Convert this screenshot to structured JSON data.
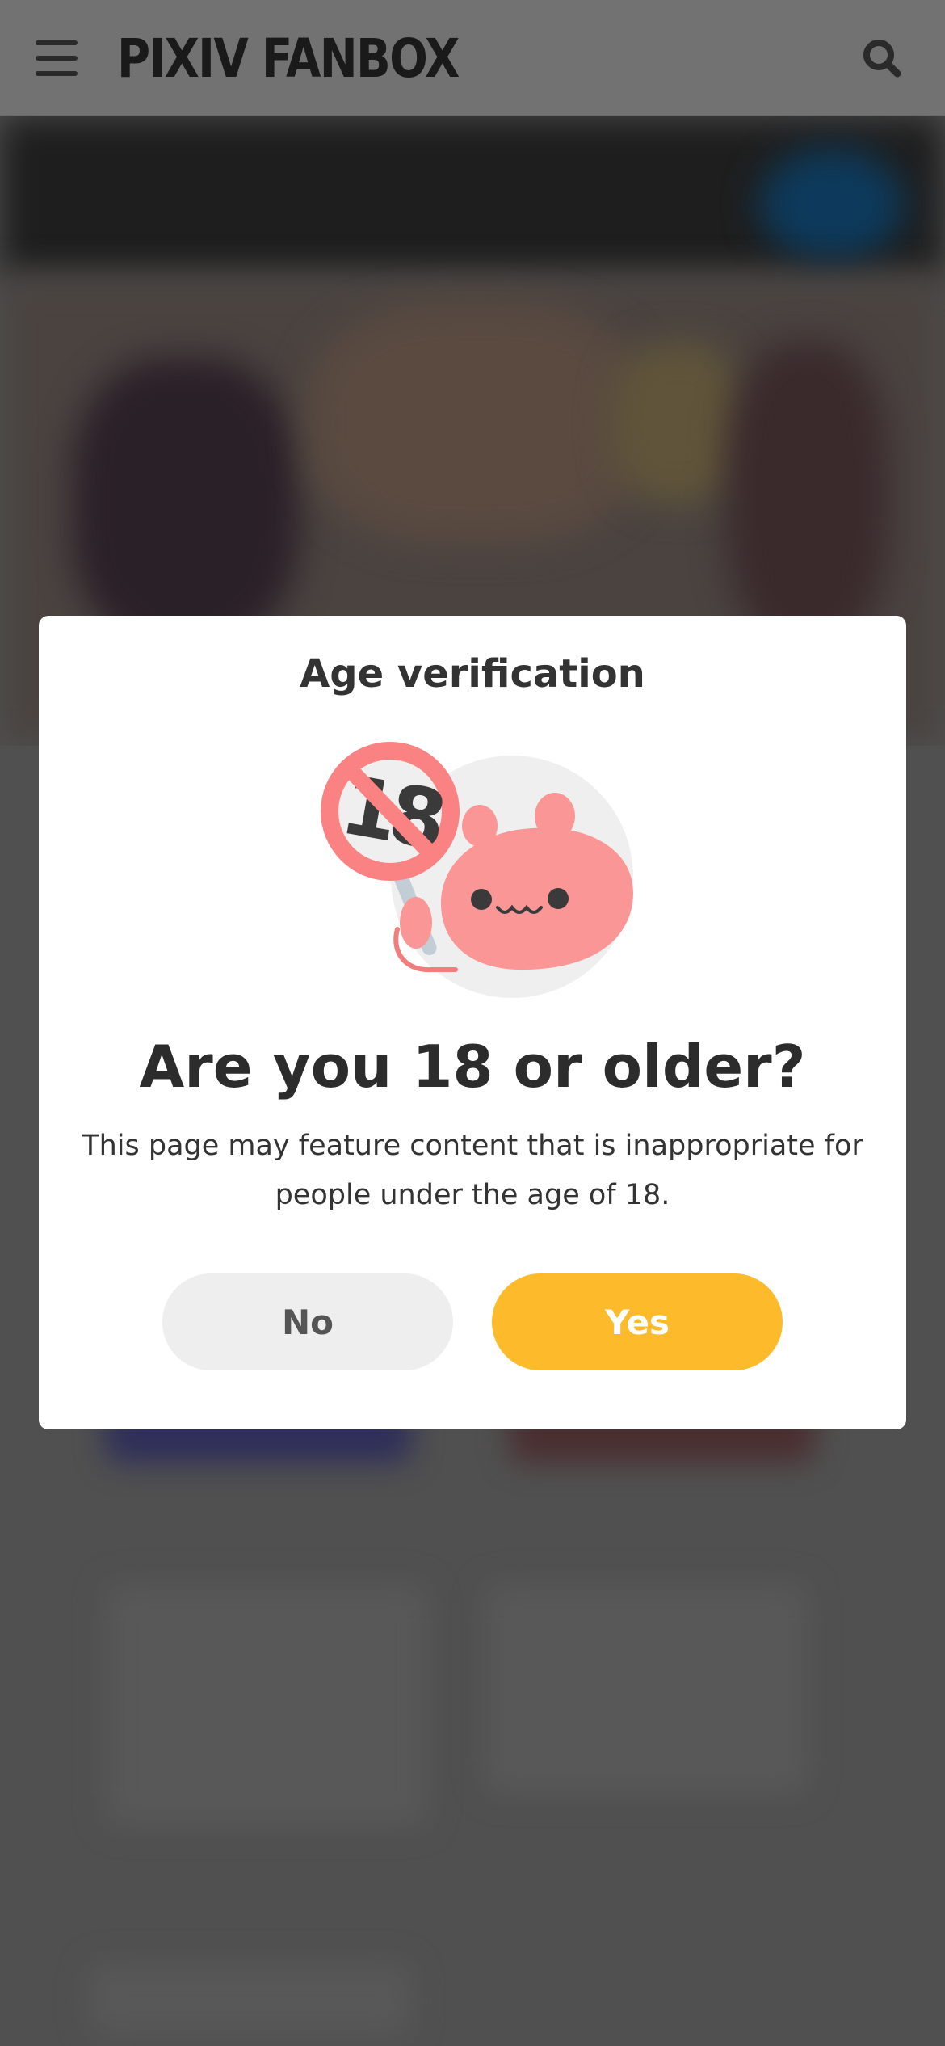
{
  "header": {
    "logo_text": "PIXIV FANBOX",
    "menu_icon": "hamburger-menu-icon",
    "search_icon": "search-icon"
  },
  "modal": {
    "title": "Age verification",
    "illustration": "no-under-18-mascot",
    "question": "Are you 18 or older?",
    "description": "This page may feature content that is inappropriate for people under the age of 18.",
    "no_label": "No",
    "yes_label": "Yes"
  },
  "colors": {
    "accent": "#fdba2b",
    "overlay": "#505050",
    "header": "#727272"
  }
}
